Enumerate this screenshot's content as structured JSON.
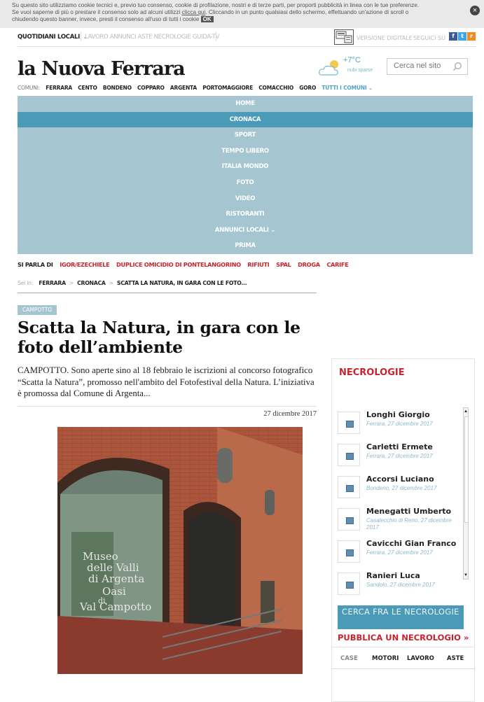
{
  "cookie": {
    "text1": "Su questo sito utilizziamo cookie tecnici e, previo tuo consenso, cookie di profilazione, nostri e di terze parti, per proporti pubblicità in linea con le tue preferenze.",
    "text2": "Se vuoi saperne di più o prestare il consenso solo ad alcuni utilizzi",
    "link": "clicca qui",
    "text3": ". Cliccando in un punto qualsiasi dello schermo, effettuando un'azione di scroll o",
    "text4": "chiudendo questo banner, invece, presti il consenso all'uso di tutti i cookie",
    "ok": "OK",
    "close": "×"
  },
  "topbar": {
    "quotidiani": "QUOTIDIANI LOCALI",
    "links": "LAVORO  ANNUNCI  ASTE  NECROLOGIE  GUIDA-TV",
    "versione": "VERSIONE DIGITALE",
    "seguici": "SEGUICI SU",
    "social": [
      "f",
      "t",
      "r"
    ]
  },
  "header": {
    "logo": "la Nuova Ferrara",
    "temp": "+7°C",
    "weather": "nubi sparse",
    "search_placeholder": "Cerca nel sito"
  },
  "comuni": {
    "label": "COMUNI:",
    "items": [
      "FERRARA",
      "CENTO",
      "BONDENO",
      "COPPARO",
      "ARGENTA",
      "PORTOMAGGIORE",
      "COMACCHIO",
      "GORO"
    ],
    "all": "TUTTI I COMUNI ⌄"
  },
  "nav": [
    "HOME",
    "CRONACA",
    "SPORT",
    "TEMPO LIBERO",
    "ITALIA MONDO",
    "FOTO",
    "VIDEO",
    "RISTORANTI",
    "ANNUNCI LOCALI ⌄",
    "PRIMA"
  ],
  "siparla": {
    "label": "SI PARLA DI",
    "tags": [
      "IGOR/EZECHIELE",
      "DUPLICE OMICIDIO DI PONTELANGORINO",
      "RIFIUTI",
      "SPAL",
      "DROGA",
      "CARIFE"
    ]
  },
  "breadcrumb": {
    "label": "Sei in:",
    "items": [
      "FERRARA",
      "CRONACA",
      "SCATTA LA NATURA, IN GARA CON LE FOTO..."
    ]
  },
  "article": {
    "kicker": "CAMPOTTO",
    "title": "Scatta la Natura, in gara con le foto dell’ambiente",
    "lead": "CAMPOTTO. Sono aperte sino al 18 febbraio le iscrizioni al concorso fotografico “Scatta la Natura”, promosso nell'ambito del Fotofestival della Natura. L’iniziativa è promossa dal Comune di Argenta...",
    "date": "27 dicembre 2017",
    "photo_text": [
      "Museo",
      "delle Valli",
      "di Argenta",
      "Oasi",
      "di",
      "Val Campotto"
    ]
  },
  "necrologie": {
    "title": "NECROLOGIE",
    "items": [
      {
        "name": "Longhi Giorgio",
        "place": "Ferrara, 27 dicembre 2017"
      },
      {
        "name": "Carletti Ermete",
        "place": "Ferrara, 27 dicembre 2017"
      },
      {
        "name": "Accorsi Luciano",
        "place": "Bondeno, 27 dicembre 2017"
      },
      {
        "name": "Menegatti Umberto",
        "place": "Casalecchio di Reno, 27 dicembre 2017"
      },
      {
        "name": "Cavicchi Gian Franco",
        "place": "Ferrara, 27 dicembre 2017"
      },
      {
        "name": "Ranieri Luca",
        "place": "Sandolo, 27 dicembre 2017"
      }
    ],
    "cerca": "CERCA FRA LE NECROLOGIE",
    "pubblica": "PUBBLICA UN NECROLOGIO »"
  },
  "tabs": [
    "CASE",
    "MOTORI",
    "LAVORO",
    "ASTE"
  ],
  "colors": {
    "accent": "#4a9ab8",
    "nav": "#a5c6d0",
    "red": "#c8232c"
  }
}
